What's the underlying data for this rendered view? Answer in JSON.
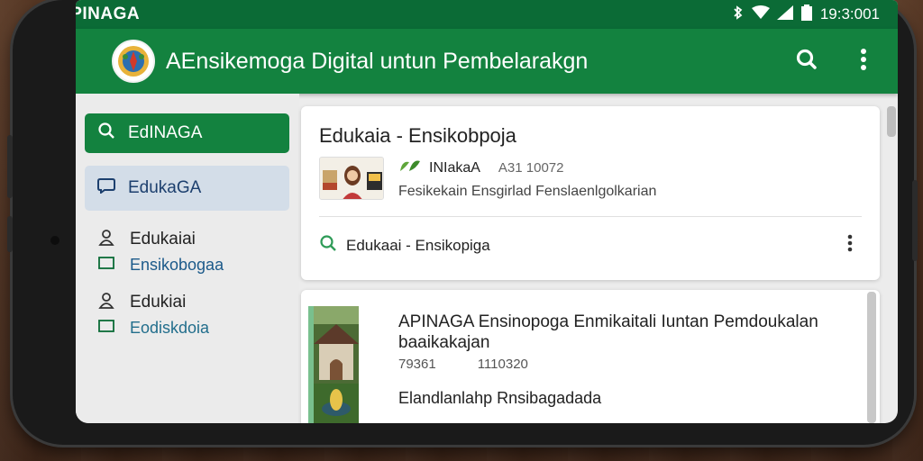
{
  "status": {
    "carrier": "APINAGA",
    "time": "19:3:001"
  },
  "appbar": {
    "title": "AEnsikemoga Digital untun Pembelarakgn"
  },
  "sidebar": {
    "items": [
      {
        "label": "EdINAGA"
      },
      {
        "label": "EdukaGA"
      },
      {
        "label": "Edukaiai",
        "sub": "Ensikobogaa"
      },
      {
        "label": "Edukiai",
        "sub": "Eodiskdoia"
      }
    ]
  },
  "card1": {
    "title": "Edukaia - Ensikobpoja",
    "author": "INIakaA",
    "number": "A31 10072",
    "subtitle": "Fesikekain Ensgirlad Fenslaenlgolkarian",
    "search_text": "Edukaai - Ensikopiga"
  },
  "card2": {
    "title": "APINAGA Ensinopoga Enmikaitali Iuntan Pemdoukalan baaikakajan",
    "num1": "79361",
    "num2": "1110320",
    "subtitle": "Elandlanlahp Rnsibagadada"
  },
  "colors": {
    "primary": "#13823f",
    "statusbar": "#0b6b36",
    "selected": "#d3dde8"
  },
  "icons": [
    "logo",
    "search-icon",
    "more-vert-icon",
    "wifi-icon",
    "signal-icon",
    "battery-icon",
    "bluetooth-icon",
    "person-icon",
    "book-icon"
  ]
}
